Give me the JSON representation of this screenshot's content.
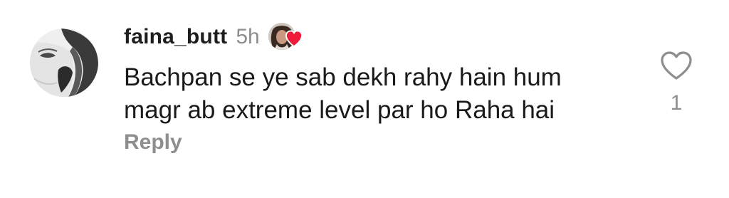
{
  "comment": {
    "username": "faina_butt",
    "time": "5h",
    "liked_by_author": true,
    "icons": {
      "author_like": "heart-icon",
      "like": "heart-outline-icon"
    },
    "text": "Bachpan se ye sab dekh rahy hain hum magr ab extreme level par ho Raha hai",
    "reply_label": "Reply",
    "like_count": "1",
    "colors": {
      "username": "#1e1e1e",
      "muted": "#8e8e8e",
      "heart": "#ed1c3a"
    }
  }
}
